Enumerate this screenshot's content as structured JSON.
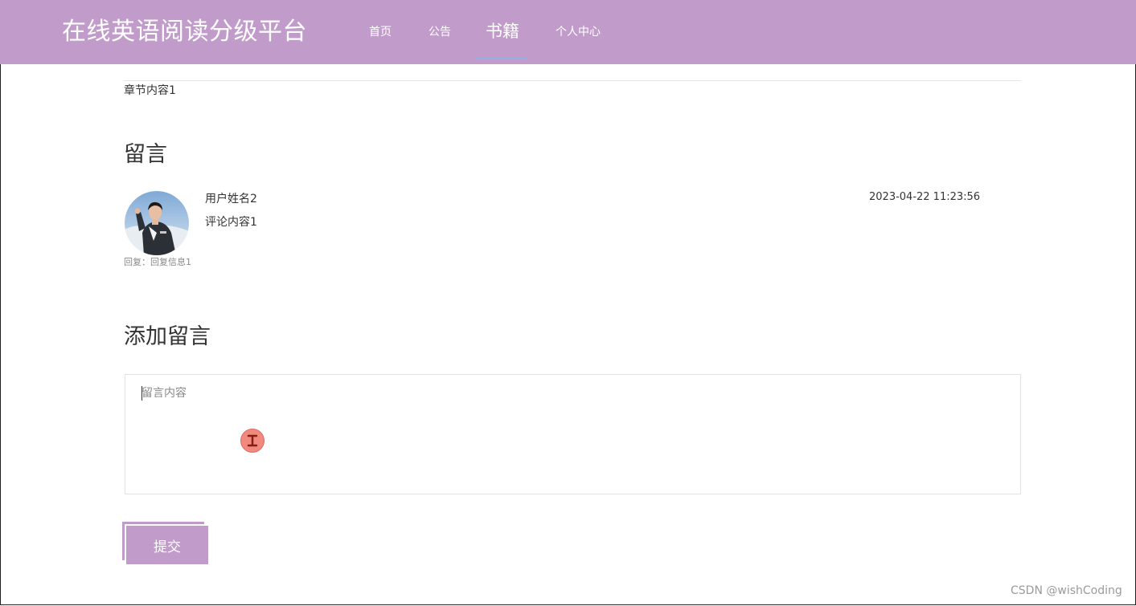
{
  "header": {
    "brand": "在线英语阅读分级平台",
    "nav": [
      {
        "label": "首页"
      },
      {
        "label": "公告"
      },
      {
        "label": "书籍",
        "active": true
      },
      {
        "label": "个人中心"
      }
    ]
  },
  "chapter": {
    "content": "章节内容1"
  },
  "comments": {
    "title": "留言",
    "items": [
      {
        "user": "用户姓名2",
        "text": "评论内容1",
        "time": "2023-04-22 11:23:56",
        "reply": "回复：回复信息1"
      }
    ]
  },
  "add_comment": {
    "title": "添加留言",
    "placeholder": "留言内容",
    "value": "",
    "submit_label": "提交"
  },
  "colors": {
    "primary": "#c19ccb",
    "nav_active_underline": "#8fb2e6",
    "cursor_marker": "#f08a7e"
  },
  "icons": {
    "cursor": "text-cursor-icon"
  },
  "watermark": "CSDN @wishCoding"
}
